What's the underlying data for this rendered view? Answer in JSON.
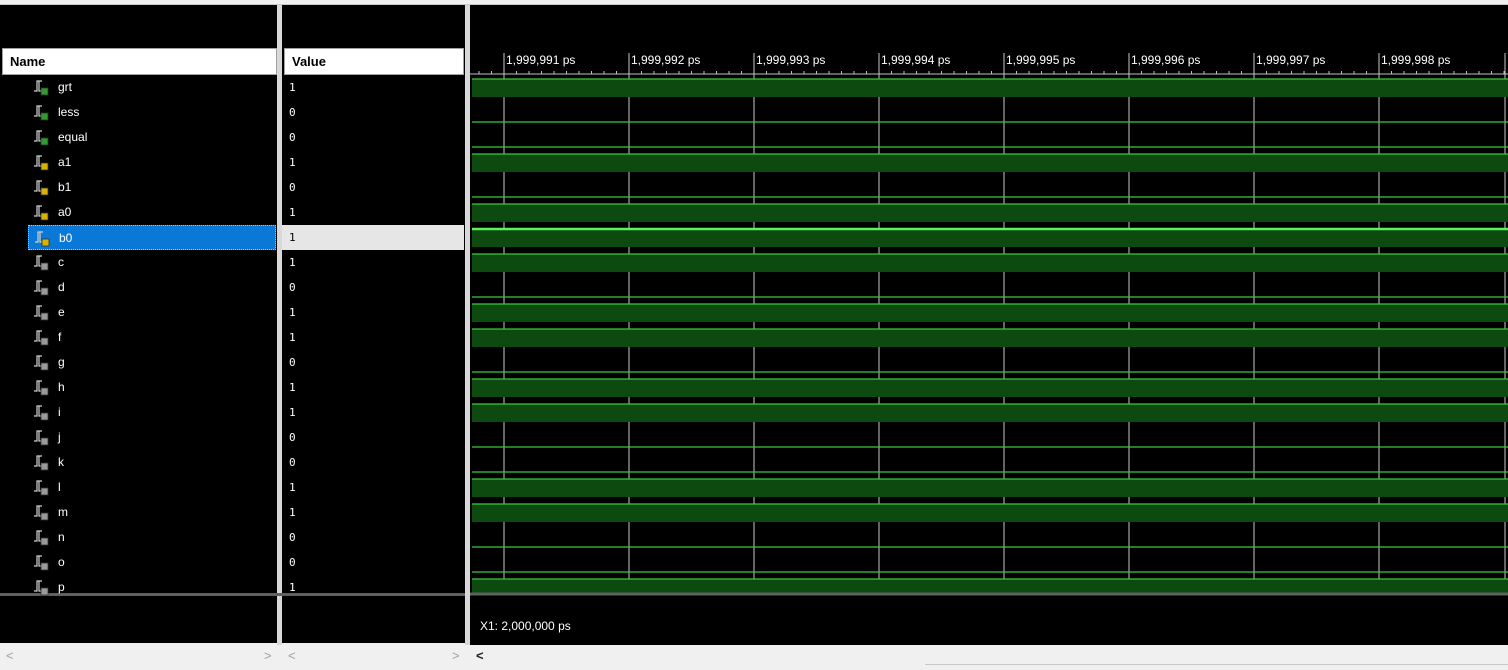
{
  "columns": {
    "name_header": "Name",
    "value_header": "Value"
  },
  "signals": [
    {
      "name": "grt",
      "value": "1",
      "type": "output"
    },
    {
      "name": "less",
      "value": "0",
      "type": "output"
    },
    {
      "name": "equal",
      "value": "0",
      "type": "output"
    },
    {
      "name": "a1",
      "value": "1",
      "type": "input"
    },
    {
      "name": "b1",
      "value": "0",
      "type": "input"
    },
    {
      "name": "a0",
      "value": "1",
      "type": "input"
    },
    {
      "name": "b0",
      "value": "1",
      "type": "input",
      "selected": true
    },
    {
      "name": "c",
      "value": "1",
      "type": "internal"
    },
    {
      "name": "d",
      "value": "0",
      "type": "internal"
    },
    {
      "name": "e",
      "value": "1",
      "type": "internal"
    },
    {
      "name": "f",
      "value": "1",
      "type": "internal"
    },
    {
      "name": "g",
      "value": "0",
      "type": "internal"
    },
    {
      "name": "h",
      "value": "1",
      "type": "internal"
    },
    {
      "name": "i",
      "value": "1",
      "type": "internal"
    },
    {
      "name": "j",
      "value": "0",
      "type": "internal"
    },
    {
      "name": "k",
      "value": "0",
      "type": "internal"
    },
    {
      "name": "l",
      "value": "1",
      "type": "internal"
    },
    {
      "name": "m",
      "value": "1",
      "type": "internal"
    },
    {
      "name": "n",
      "value": "0",
      "type": "internal"
    },
    {
      "name": "o",
      "value": "0",
      "type": "internal"
    },
    {
      "name": "p",
      "value": "1",
      "type": "internal"
    }
  ],
  "timeline": {
    "ticks": [
      "1,999,991 ps",
      "1,999,992 ps",
      "1,999,993 ps",
      "1,999,994 ps",
      "1,999,995 ps",
      "1,999,996 ps",
      "1,999,997 ps",
      "1,999,998 ps"
    ]
  },
  "cursor": {
    "label": "X1: 2,000,000 ps"
  },
  "scroll": {
    "left_arrow": "<",
    "right_arrow": ">"
  },
  "colors": {
    "background": "#000000",
    "waveform_line": "#39c939",
    "waveform_fill": "#0d4a10",
    "selected_wave": "#5cf05c",
    "selection": "#0a78d7",
    "gridline": "#c8c8c8"
  }
}
